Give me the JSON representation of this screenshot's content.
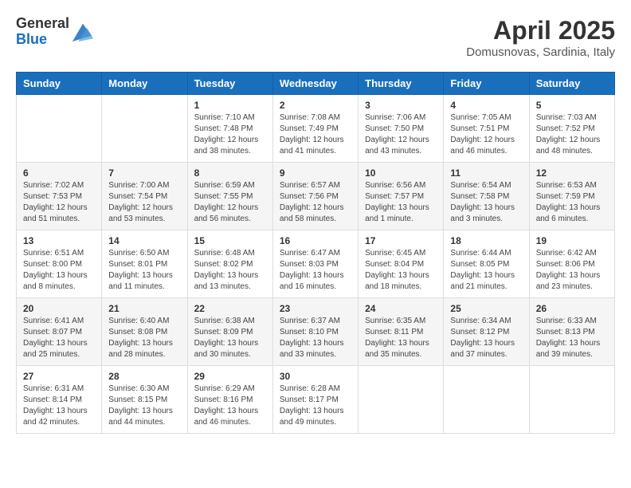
{
  "header": {
    "logo_general": "General",
    "logo_blue": "Blue",
    "month_title": "April 2025",
    "location": "Domusnovas, Sardinia, Italy"
  },
  "weekdays": [
    "Sunday",
    "Monday",
    "Tuesday",
    "Wednesday",
    "Thursday",
    "Friday",
    "Saturday"
  ],
  "weeks": [
    [
      {
        "day": "",
        "info": ""
      },
      {
        "day": "",
        "info": ""
      },
      {
        "day": "1",
        "info": "Sunrise: 7:10 AM\nSunset: 7:48 PM\nDaylight: 12 hours and 38 minutes."
      },
      {
        "day": "2",
        "info": "Sunrise: 7:08 AM\nSunset: 7:49 PM\nDaylight: 12 hours and 41 minutes."
      },
      {
        "day": "3",
        "info": "Sunrise: 7:06 AM\nSunset: 7:50 PM\nDaylight: 12 hours and 43 minutes."
      },
      {
        "day": "4",
        "info": "Sunrise: 7:05 AM\nSunset: 7:51 PM\nDaylight: 12 hours and 46 minutes."
      },
      {
        "day": "5",
        "info": "Sunrise: 7:03 AM\nSunset: 7:52 PM\nDaylight: 12 hours and 48 minutes."
      }
    ],
    [
      {
        "day": "6",
        "info": "Sunrise: 7:02 AM\nSunset: 7:53 PM\nDaylight: 12 hours and 51 minutes."
      },
      {
        "day": "7",
        "info": "Sunrise: 7:00 AM\nSunset: 7:54 PM\nDaylight: 12 hours and 53 minutes."
      },
      {
        "day": "8",
        "info": "Sunrise: 6:59 AM\nSunset: 7:55 PM\nDaylight: 12 hours and 56 minutes."
      },
      {
        "day": "9",
        "info": "Sunrise: 6:57 AM\nSunset: 7:56 PM\nDaylight: 12 hours and 58 minutes."
      },
      {
        "day": "10",
        "info": "Sunrise: 6:56 AM\nSunset: 7:57 PM\nDaylight: 13 hours and 1 minute."
      },
      {
        "day": "11",
        "info": "Sunrise: 6:54 AM\nSunset: 7:58 PM\nDaylight: 13 hours and 3 minutes."
      },
      {
        "day": "12",
        "info": "Sunrise: 6:53 AM\nSunset: 7:59 PM\nDaylight: 13 hours and 6 minutes."
      }
    ],
    [
      {
        "day": "13",
        "info": "Sunrise: 6:51 AM\nSunset: 8:00 PM\nDaylight: 13 hours and 8 minutes."
      },
      {
        "day": "14",
        "info": "Sunrise: 6:50 AM\nSunset: 8:01 PM\nDaylight: 13 hours and 11 minutes."
      },
      {
        "day": "15",
        "info": "Sunrise: 6:48 AM\nSunset: 8:02 PM\nDaylight: 13 hours and 13 minutes."
      },
      {
        "day": "16",
        "info": "Sunrise: 6:47 AM\nSunset: 8:03 PM\nDaylight: 13 hours and 16 minutes."
      },
      {
        "day": "17",
        "info": "Sunrise: 6:45 AM\nSunset: 8:04 PM\nDaylight: 13 hours and 18 minutes."
      },
      {
        "day": "18",
        "info": "Sunrise: 6:44 AM\nSunset: 8:05 PM\nDaylight: 13 hours and 21 minutes."
      },
      {
        "day": "19",
        "info": "Sunrise: 6:42 AM\nSunset: 8:06 PM\nDaylight: 13 hours and 23 minutes."
      }
    ],
    [
      {
        "day": "20",
        "info": "Sunrise: 6:41 AM\nSunset: 8:07 PM\nDaylight: 13 hours and 25 minutes."
      },
      {
        "day": "21",
        "info": "Sunrise: 6:40 AM\nSunset: 8:08 PM\nDaylight: 13 hours and 28 minutes."
      },
      {
        "day": "22",
        "info": "Sunrise: 6:38 AM\nSunset: 8:09 PM\nDaylight: 13 hours and 30 minutes."
      },
      {
        "day": "23",
        "info": "Sunrise: 6:37 AM\nSunset: 8:10 PM\nDaylight: 13 hours and 33 minutes."
      },
      {
        "day": "24",
        "info": "Sunrise: 6:35 AM\nSunset: 8:11 PM\nDaylight: 13 hours and 35 minutes."
      },
      {
        "day": "25",
        "info": "Sunrise: 6:34 AM\nSunset: 8:12 PM\nDaylight: 13 hours and 37 minutes."
      },
      {
        "day": "26",
        "info": "Sunrise: 6:33 AM\nSunset: 8:13 PM\nDaylight: 13 hours and 39 minutes."
      }
    ],
    [
      {
        "day": "27",
        "info": "Sunrise: 6:31 AM\nSunset: 8:14 PM\nDaylight: 13 hours and 42 minutes."
      },
      {
        "day": "28",
        "info": "Sunrise: 6:30 AM\nSunset: 8:15 PM\nDaylight: 13 hours and 44 minutes."
      },
      {
        "day": "29",
        "info": "Sunrise: 6:29 AM\nSunset: 8:16 PM\nDaylight: 13 hours and 46 minutes."
      },
      {
        "day": "30",
        "info": "Sunrise: 6:28 AM\nSunset: 8:17 PM\nDaylight: 13 hours and 49 minutes."
      },
      {
        "day": "",
        "info": ""
      },
      {
        "day": "",
        "info": ""
      },
      {
        "day": "",
        "info": ""
      }
    ]
  ]
}
